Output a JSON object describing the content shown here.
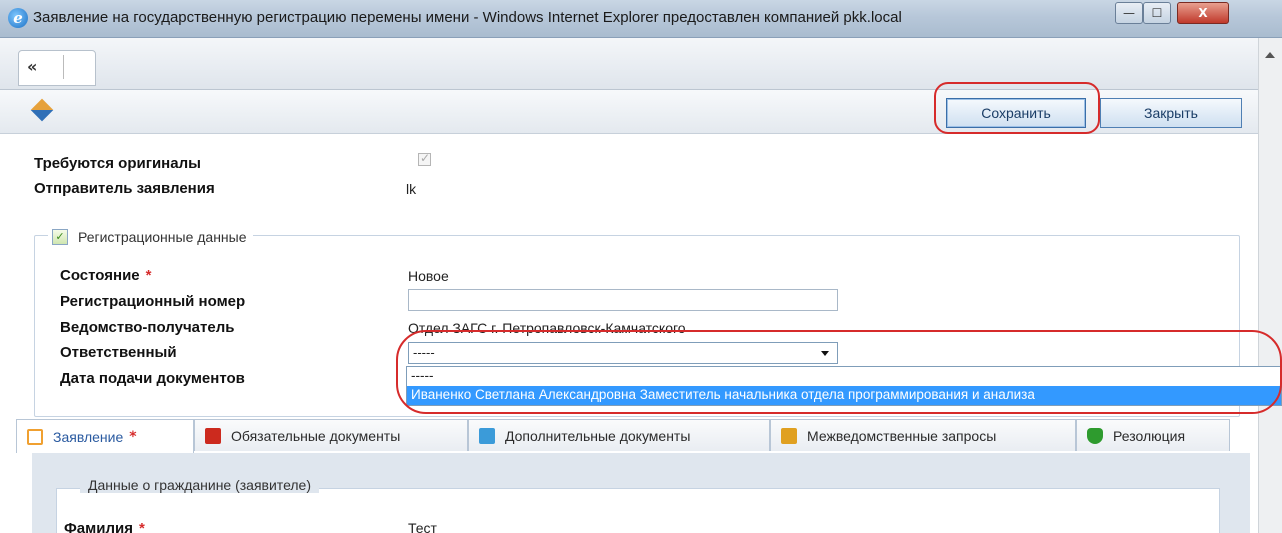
{
  "window": {
    "title": "Заявление на государственную регистрацию перемены имени - Windows Internet Explorer предоставлен компанией pkk.local",
    "min_glyph": "—",
    "max_glyph": "☐",
    "close_glyph": "X"
  },
  "nav": {
    "collapse_label": "«"
  },
  "toolbar": {
    "save_label": "Сохранить",
    "close_label": "Закрыть"
  },
  "form": {
    "originals_required_label": "Требуются оригиналы",
    "originals_required_checked": true,
    "sender_label": "Отправитель заявления",
    "sender_value": "lk",
    "registration_section_title": "Регистрационные данные",
    "status_label": "Состояние",
    "required_mark": "*",
    "status_value": "Новое",
    "reg_number_label": "Регистрационный номер",
    "reg_number_value": "",
    "recipient_label": "Ведомство-получатель",
    "recipient_value": "Отдел ЗАГС г. Петропавловск-Камчатского",
    "responsible_label": "Ответственный",
    "responsible_value": "-----",
    "submit_date_label": "Дата подачи документов",
    "responsible_options": [
      "-----",
      "Иваненко Светлана Александровна Заместитель начальника отдела программирования и анализа"
    ]
  },
  "tabs": [
    {
      "label": "Заявление",
      "required": true,
      "icon": "document-icon",
      "color": "#f0a030"
    },
    {
      "label": "Обязательные документы",
      "required": false,
      "icon": "red-folder-icon",
      "color": "#cc2a1e"
    },
    {
      "label": "Дополнительные документы",
      "required": false,
      "icon": "blue-folder-icon",
      "color": "#3b9bd9"
    },
    {
      "label": "Межведомственные запросы",
      "required": false,
      "icon": "user-request-icon",
      "color": "#e0a020"
    },
    {
      "label": "Резолюция",
      "required": false,
      "icon": "green-shield-icon",
      "color": "#2e9b2e"
    }
  ],
  "applicant": {
    "section_title": "Данные о гражданине (заявителе)",
    "surname_label": "Фамилия",
    "surname_value": "Тест"
  },
  "colors": {
    "accent": "#3399ff",
    "annotation": "#d62b2b"
  }
}
